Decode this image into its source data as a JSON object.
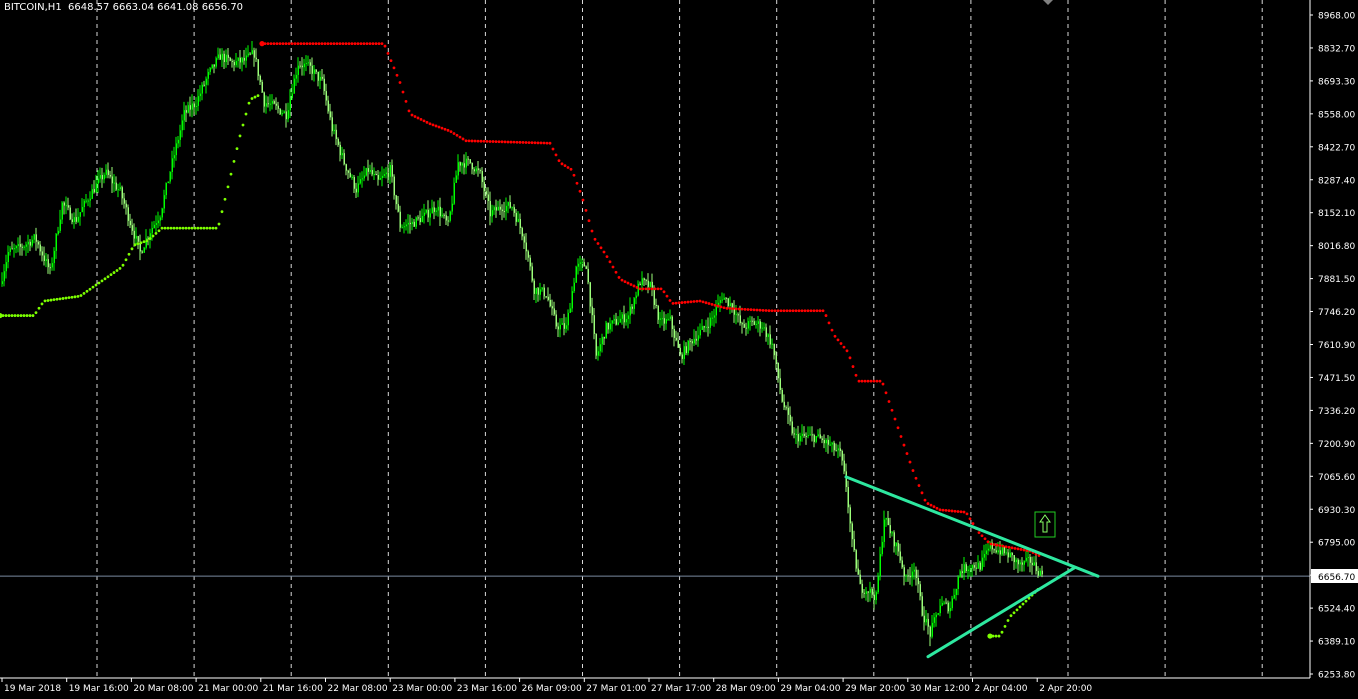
{
  "symbol": {
    "name": "BITCOIN,H1",
    "open": "6648.57",
    "high": "6663.04",
    "low": "6641.08",
    "close": "6656.70"
  },
  "price_axis": {
    "labels": [
      "8968.00",
      "8832.70",
      "8693.30",
      "8558.00",
      "8422.70",
      "8287.40",
      "8152.10",
      "8016.80",
      "7881.50",
      "7746.20",
      "7610.90",
      "7471.50",
      "7336.20",
      "7200.90",
      "7065.60",
      "6930.30",
      "6795.00",
      "6656.70",
      "6524.40",
      "6389.10",
      "6253.80"
    ],
    "current_price": "6656.70"
  },
  "time_axis": {
    "labels": [
      "19 Mar 2018",
      "19 Mar 16:00",
      "20 Mar 08:00",
      "21 Mar 00:00",
      "21 Mar 16:00",
      "22 Mar 08:00",
      "23 Mar 00:00",
      "23 Mar 16:00",
      "26 Mar 09:00",
      "27 Mar 01:00",
      "27 Mar 17:00",
      "28 Mar 09:00",
      "29 Mar 04:00",
      "29 Mar 20:00",
      "30 Mar 12:00",
      "2 Apr 04:00",
      "2 Apr 20:00"
    ]
  },
  "colors": {
    "background": "#000000",
    "candle_bull": "#00ff00",
    "candle_bear": "#9cff7a",
    "stop_red": "#ff0000",
    "stop_green": "#7cff00",
    "trendline": "#2ee8a0",
    "grid": "#ffffff",
    "current_price_line": "#7a8aa0"
  },
  "icons": {
    "signal": "up-arrow-signal-icon",
    "scroll_marker": "chart-shift-marker-icon"
  },
  "chart_data": {
    "type": "candlestick",
    "ylim": [
      6253.8,
      8968.0
    ],
    "series": [
      {
        "name": "",
        "kind": "price",
        "anchors": [
          [
            0,
            7860
          ],
          [
            8,
            7990
          ],
          [
            20,
            8010
          ],
          [
            35,
            8050
          ],
          [
            50,
            7910
          ],
          [
            62,
            8190
          ],
          [
            75,
            8120
          ],
          [
            90,
            8230
          ],
          [
            105,
            8320
          ],
          [
            120,
            8240
          ],
          [
            140,
            7990
          ],
          [
            150,
            8080
          ],
          [
            160,
            8150
          ],
          [
            172,
            8360
          ],
          [
            184,
            8560
          ],
          [
            196,
            8610
          ],
          [
            208,
            8720
          ],
          [
            220,
            8800
          ],
          [
            232,
            8770
          ],
          [
            244,
            8780
          ],
          [
            254,
            8810
          ],
          [
            264,
            8610
          ],
          [
            274,
            8590
          ],
          [
            286,
            8560
          ],
          [
            298,
            8770
          ],
          [
            310,
            8750
          ],
          [
            322,
            8690
          ],
          [
            332,
            8500
          ],
          [
            344,
            8360
          ],
          [
            356,
            8250
          ],
          [
            368,
            8330
          ],
          [
            378,
            8280
          ],
          [
            390,
            8330
          ],
          [
            400,
            8100
          ],
          [
            412,
            8110
          ],
          [
            424,
            8140
          ],
          [
            436,
            8180
          ],
          [
            448,
            8100
          ],
          [
            458,
            8360
          ],
          [
            470,
            8360
          ],
          [
            480,
            8310
          ],
          [
            490,
            8150
          ],
          [
            502,
            8180
          ],
          [
            512,
            8180
          ],
          [
            524,
            8050
          ],
          [
            534,
            7840
          ],
          [
            546,
            7820
          ],
          [
            556,
            7690
          ],
          [
            566,
            7680
          ],
          [
            576,
            7930
          ],
          [
            586,
            7940
          ],
          [
            596,
            7560
          ],
          [
            606,
            7680
          ],
          [
            618,
            7710
          ],
          [
            628,
            7730
          ],
          [
            640,
            7870
          ],
          [
            650,
            7850
          ],
          [
            660,
            7700
          ],
          [
            670,
            7710
          ],
          [
            680,
            7560
          ],
          [
            692,
            7630
          ],
          [
            702,
            7670
          ],
          [
            712,
            7720
          ],
          [
            722,
            7810
          ],
          [
            732,
            7770
          ],
          [
            742,
            7680
          ],
          [
            752,
            7700
          ],
          [
            762,
            7690
          ],
          [
            772,
            7610
          ],
          [
            782,
            7380
          ],
          [
            794,
            7230
          ],
          [
            806,
            7230
          ],
          [
            816,
            7230
          ],
          [
            828,
            7200
          ],
          [
            840,
            7160
          ],
          [
            846,
            7030
          ],
          [
            852,
            6790
          ],
          [
            860,
            6610
          ],
          [
            868,
            6600
          ],
          [
            876,
            6570
          ],
          [
            884,
            6900
          ],
          [
            890,
            6840
          ],
          [
            898,
            6760
          ],
          [
            906,
            6640
          ],
          [
            914,
            6700
          ],
          [
            922,
            6510
          ],
          [
            930,
            6420
          ],
          [
            940,
            6540
          ],
          [
            950,
            6530
          ],
          [
            960,
            6680
          ],
          [
            970,
            6700
          ],
          [
            980,
            6700
          ],
          [
            990,
            6780
          ],
          [
            1000,
            6760
          ],
          [
            1010,
            6740
          ],
          [
            1020,
            6700
          ],
          [
            1030,
            6720
          ],
          [
            1040,
            6670
          ],
          [
            1043,
            6660
          ]
        ]
      },
      {
        "name": "",
        "kind": "stop-red",
        "anchors": [
          [
            262,
            8850
          ],
          [
            384,
            8850
          ],
          [
            400,
            8690
          ],
          [
            410,
            8560
          ],
          [
            430,
            8520
          ],
          [
            450,
            8490
          ],
          [
            466,
            8450
          ],
          [
            550,
            8440
          ],
          [
            560,
            8360
          ],
          [
            572,
            8330
          ],
          [
            582,
            8220
          ],
          [
            594,
            8050
          ],
          [
            606,
            7980
          ],
          [
            620,
            7880
          ],
          [
            640,
            7840
          ],
          [
            662,
            7840
          ],
          [
            672,
            7780
          ],
          [
            700,
            7790
          ],
          [
            726,
            7760
          ],
          [
            770,
            7750
          ],
          [
            824,
            7750
          ],
          [
            834,
            7650
          ],
          [
            848,
            7580
          ],
          [
            858,
            7460
          ],
          [
            882,
            7460
          ],
          [
            902,
            7220
          ],
          [
            914,
            7080
          ],
          [
            926,
            6960
          ],
          [
            940,
            6930
          ],
          [
            966,
            6920
          ],
          [
            978,
            6840
          ],
          [
            990,
            6790
          ],
          [
            1030,
            6760
          ],
          [
            1040,
            6740
          ]
        ]
      },
      {
        "name": "",
        "kind": "stop-green",
        "anchors": [
          [
            0,
            7730
          ],
          [
            34,
            7730
          ],
          [
            44,
            7790
          ],
          [
            80,
            7810
          ],
          [
            108,
            7890
          ],
          [
            122,
            7930
          ],
          [
            134,
            8020
          ],
          [
            148,
            8040
          ],
          [
            162,
            8090
          ],
          [
            218,
            8090
          ],
          [
            228,
            8260
          ],
          [
            240,
            8470
          ],
          [
            250,
            8620
          ],
          [
            260,
            8640
          ]
        ]
      },
      {
        "name": "",
        "kind": "stop-green-2",
        "anchors": [
          [
            990,
            6410
          ],
          [
            1000,
            6410
          ],
          [
            1010,
            6490
          ],
          [
            1020,
            6530
          ],
          [
            1030,
            6570
          ],
          [
            1040,
            6610
          ]
        ]
      }
    ],
    "trendlines": [
      {
        "from": [
          846,
          7065.6
        ],
        "to": [
          1098,
          6656.7
        ]
      },
      {
        "from": [
          928,
          6325
        ],
        "to": [
          1074,
          6690
        ]
      }
    ]
  }
}
